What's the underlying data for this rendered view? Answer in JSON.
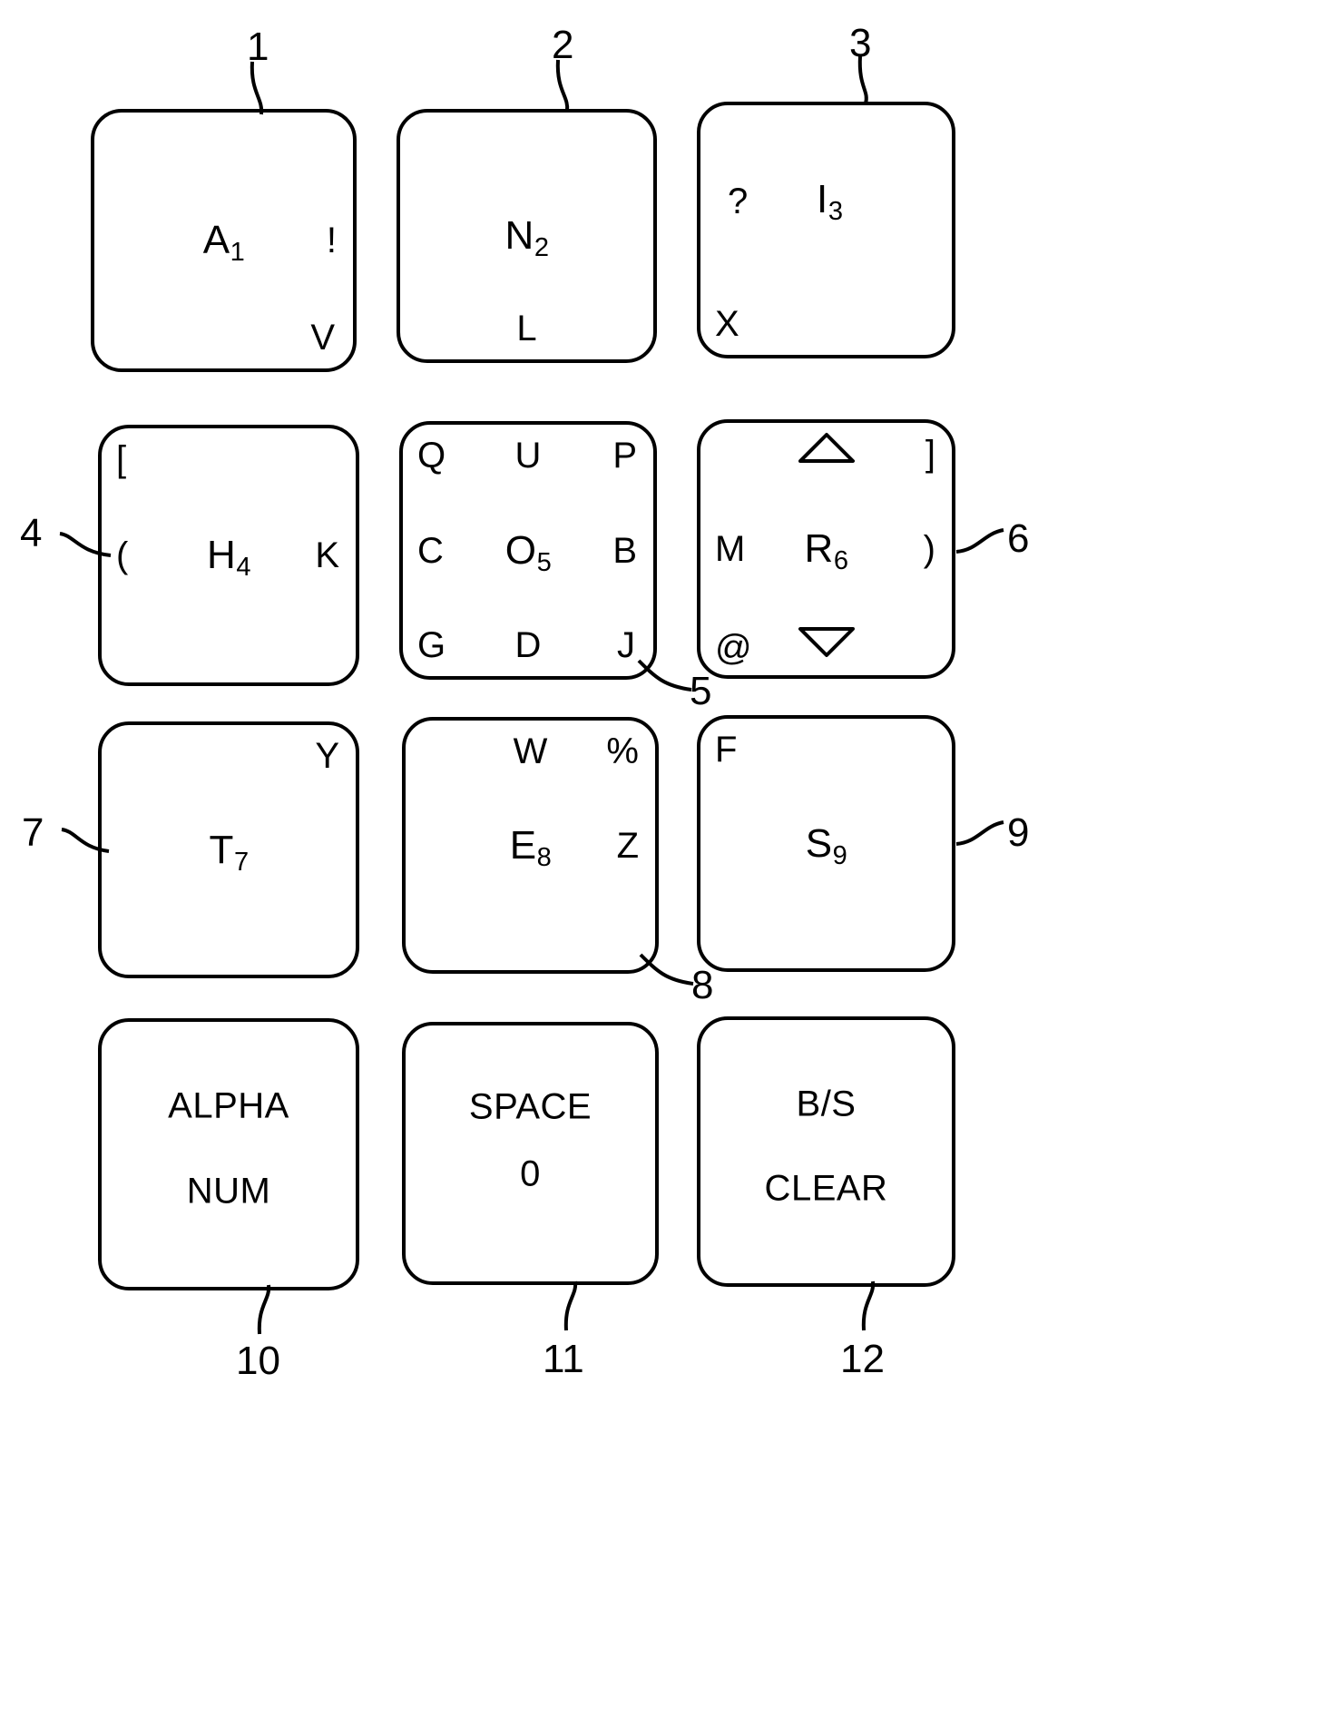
{
  "figure": {
    "title": "Keypad layout diagram",
    "keys": [
      {
        "ref": "1",
        "labels": {
          "center": "A",
          "center_sub": "1",
          "middle_right": "!",
          "bottom_right": "V"
        }
      },
      {
        "ref": "2",
        "labels": {
          "center": "N",
          "center_sub": "2",
          "bottom_center": "L"
        }
      },
      {
        "ref": "3",
        "labels": {
          "middle_left": "?",
          "center": "I",
          "center_sub": "3",
          "bottom_left": "X"
        }
      },
      {
        "ref": "4",
        "labels": {
          "top_left": "[",
          "middle_left": "(",
          "center": "H",
          "center_sub": "4",
          "middle_right": "K"
        }
      },
      {
        "ref": "5",
        "labels": {
          "top_left": "Q",
          "top_center": "U",
          "top_right": "P",
          "middle_left": "C",
          "center": "O",
          "center_sub": "5",
          "middle_right": "B",
          "bottom_left": "G",
          "bottom_center": "D",
          "bottom_right": "J"
        }
      },
      {
        "ref": "6",
        "labels": {
          "top_center": "up-triangle-icon",
          "top_right": "]",
          "middle_left": "M",
          "center": "R",
          "center_sub": "6",
          "middle_right": ")",
          "bottom_left": "@",
          "bottom_center": "down-triangle-icon"
        }
      },
      {
        "ref": "7",
        "labels": {
          "top_right": "Y",
          "center": "T",
          "center_sub": "7"
        }
      },
      {
        "ref": "8",
        "labels": {
          "top_center": "W",
          "top_right": "%",
          "center": "E",
          "center_sub": "8",
          "middle_right": "Z"
        }
      },
      {
        "ref": "9",
        "labels": {
          "top_left": "F",
          "center": "S",
          "center_sub": "9"
        }
      },
      {
        "ref": "10",
        "labels": {
          "word_top": "ALPHA",
          "word_bottom": "NUM"
        }
      },
      {
        "ref": "11",
        "labels": {
          "word_top": "SPACE",
          "word_bottom": "0"
        }
      },
      {
        "ref": "12",
        "labels": {
          "word_top": "B/S",
          "word_bottom": "CLEAR"
        }
      }
    ]
  },
  "colors": {
    "ink": "#000000",
    "paper": "#ffffff"
  }
}
